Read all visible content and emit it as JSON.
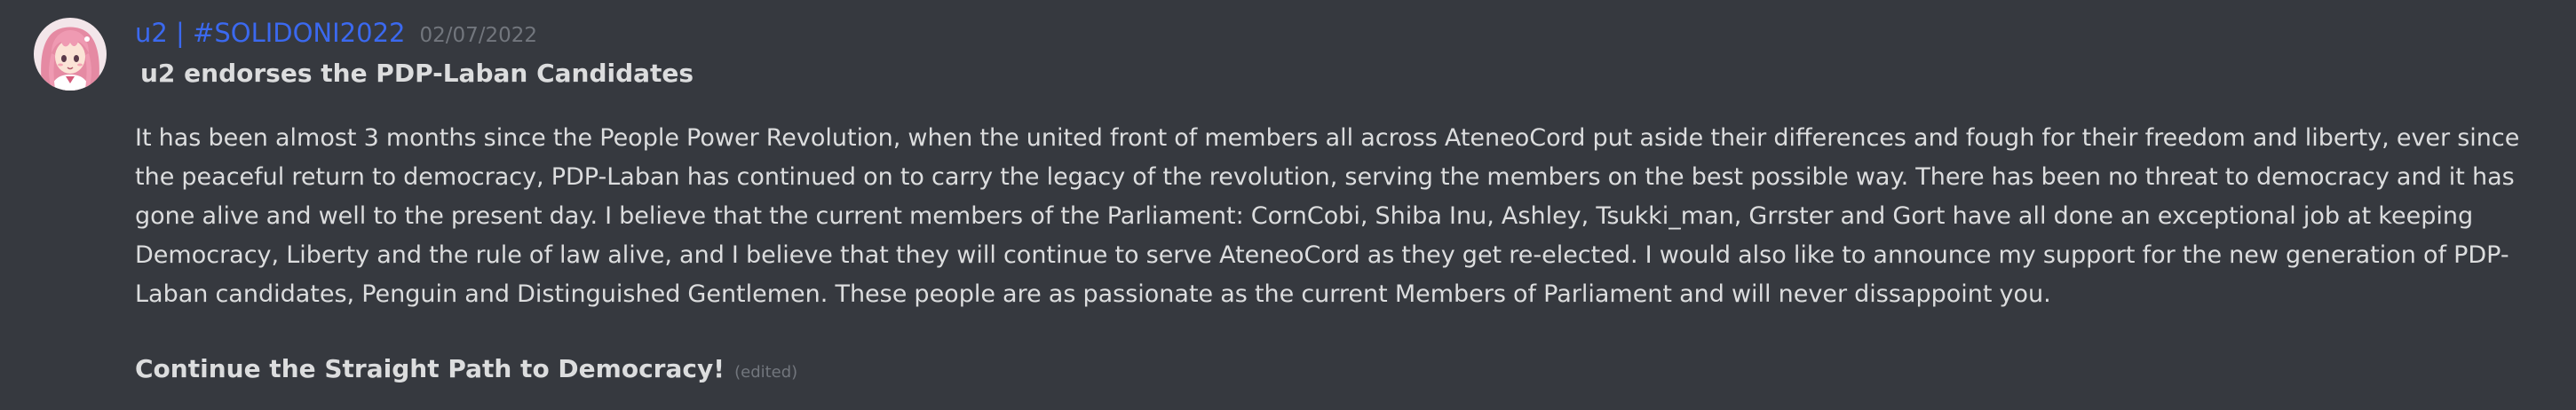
{
  "message": {
    "author": {
      "name": "u2 | #SOLIDONI2022",
      "name_color": "#3b69ef",
      "avatar_icon": "anime-pink-hair-avatar-icon"
    },
    "timestamp": "02/07/2022",
    "headline": "u2 endorses the PDP-Laban Candidates",
    "body": "It has been almost 3 months since the People Power Revolution, when the united front of members all across AteneoCord put aside their differences and fough for their freedom and liberty, ever since the peaceful return to democracy, PDP-Laban has continued on to carry the legacy of the revolution, serving the members on the best possible way. There has been no threat to democracy and it has gone alive and well to the present day. I believe that the current members of the Parliament: CornCobi, Shiba Inu, Ashley, Tsukki_man, Grrster and Gort have all done an exceptional job at keeping Democracy, Liberty and the rule of law alive, and I believe that they will continue to serve AteneoCord as they get re-elected. I would also like to announce my support for the new generation of PDP-Laban candidates, Penguin and Distinguished Gentlemen. These people are as passionate as the current Members of Parliament and will never dissappoint you.",
    "closing": "Continue the Straight Path to Democracy!",
    "edited_label": "(edited)"
  },
  "theme": {
    "background": "#36393f",
    "text": "#dcddde",
    "muted": "#72767d"
  }
}
